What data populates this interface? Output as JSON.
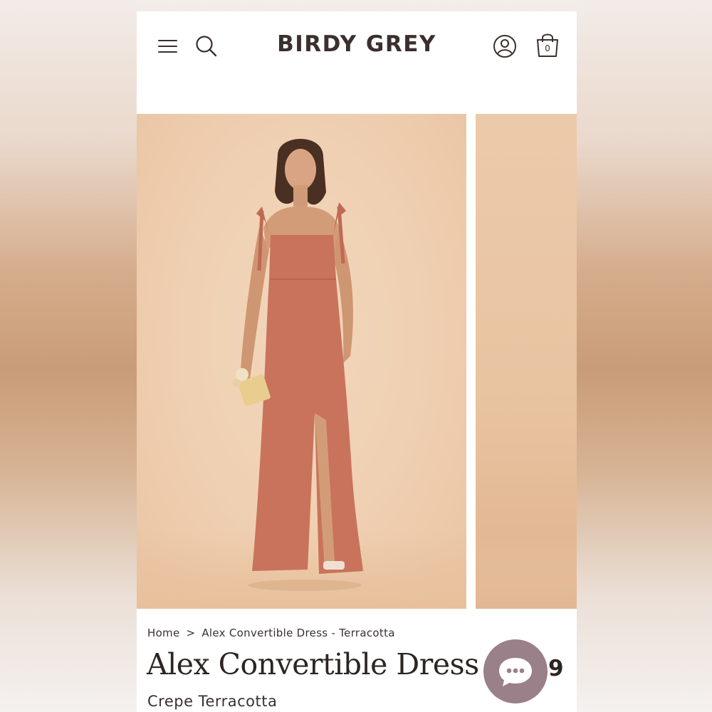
{
  "brand": {
    "name": "BIRDY GREY"
  },
  "header": {
    "menu_icon": "hamburger-menu-icon",
    "search_icon": "search-icon",
    "account_icon": "account-icon",
    "cart_icon": "shopping-bag-icon",
    "cart_count": "0"
  },
  "gallery": {
    "main_image_alt": "Model wearing terracotta convertible dress",
    "colors": {
      "dress": "#c9735c",
      "backdrop": "#efcfb1"
    }
  },
  "breadcrumb": {
    "home": "Home",
    "separator": ">",
    "current": "Alex Convertible Dress - Terracotta"
  },
  "product": {
    "title": "Alex Convertible Dress",
    "subtitle": "Crepe Terracotta",
    "price_fragment": "9"
  },
  "chat": {
    "icon": "chat-bubble-icon"
  }
}
